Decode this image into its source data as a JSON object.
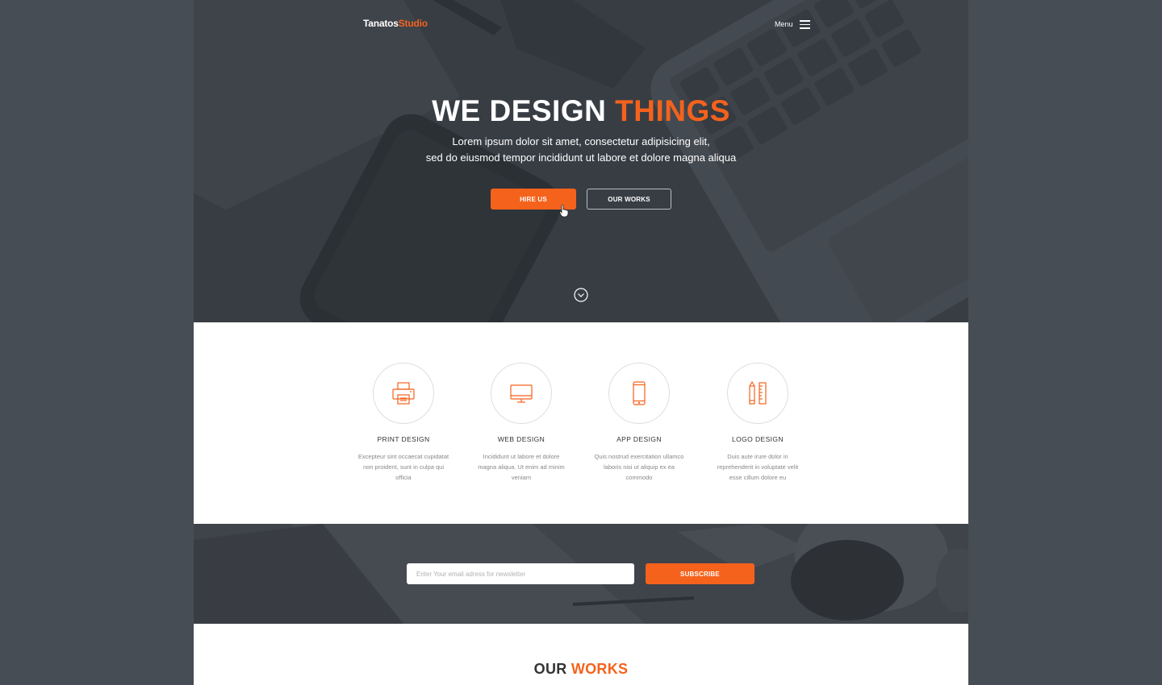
{
  "colors": {
    "accent": "#f5621c",
    "hero_bg": "#3a3f46",
    "outer_bg": "#464d55"
  },
  "header": {
    "logo_part1": "Tanatos",
    "logo_part2": "Studio",
    "menu_label": "Menu",
    "menu_icon": "hamburger-icon"
  },
  "hero": {
    "title_part1": "WE DESIGN ",
    "title_part2": "THINGS",
    "subtitle_line1": "Lorem ipsum dolor sit amet, consectetur adipisicing elit,",
    "subtitle_line2": "sed do eiusmod tempor incididunt ut labore et dolore magna aliqua",
    "hire_button": "HIRE US",
    "works_button": "OUR WORKS",
    "scroll_icon": "chevron-down-circle-icon"
  },
  "services": [
    {
      "icon": "printer-icon",
      "title": "PRINT DESIGN",
      "desc": "Excepteur sint occaecat cupidatat non proident, sunt in culpa qui officia"
    },
    {
      "icon": "monitor-icon",
      "title": "WEB DESIGN",
      "desc": "Incididunt ut labore et dolore magna aliqua. Ut enim ad minim veniam"
    },
    {
      "icon": "smartphone-icon",
      "title": "APP DESIGN",
      "desc": "Quis nostrud exercitation ullamco laboris nisi ut aliquip ex ea commodo"
    },
    {
      "icon": "pencil-ruler-icon",
      "title": "LOGO DESIGN",
      "desc": "Duis aute irure dolor in reprehenderit in voluptate velit esse cillum dolore eu"
    }
  ],
  "newsletter": {
    "placeholder": "Enter Your email adress for newsletter",
    "subscribe_button": "SUBSCRIBE"
  },
  "works": {
    "title_part1": "OUR ",
    "title_part2": "WORKS"
  }
}
